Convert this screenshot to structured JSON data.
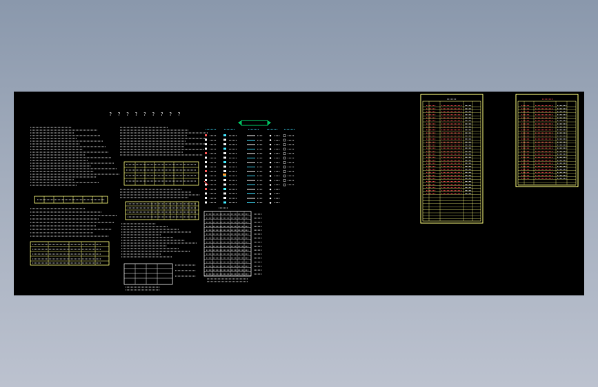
{
  "sheet": {
    "title": "? ? ? ? ? ? ? ? ?",
    "banner_text": "图 例",
    "list1_title": "? ? ? ?",
    "list2_title": "?????????"
  },
  "colors": {
    "background_outer": "#8e9bb0",
    "model_space": "#000000",
    "frame_yellow": "#ffff80",
    "text_white": "#e6e6e6",
    "text_red": "#ff5050",
    "text_cyan": "#40e0ff",
    "banner_green": "#00c060"
  },
  "legend_headers": [
    "????",
    "????",
    "????",
    "????",
    "????"
  ],
  "table1": {
    "header": [
      "????",
      "??",
      "??",
      "??",
      "??",
      "??"
    ]
  }
}
